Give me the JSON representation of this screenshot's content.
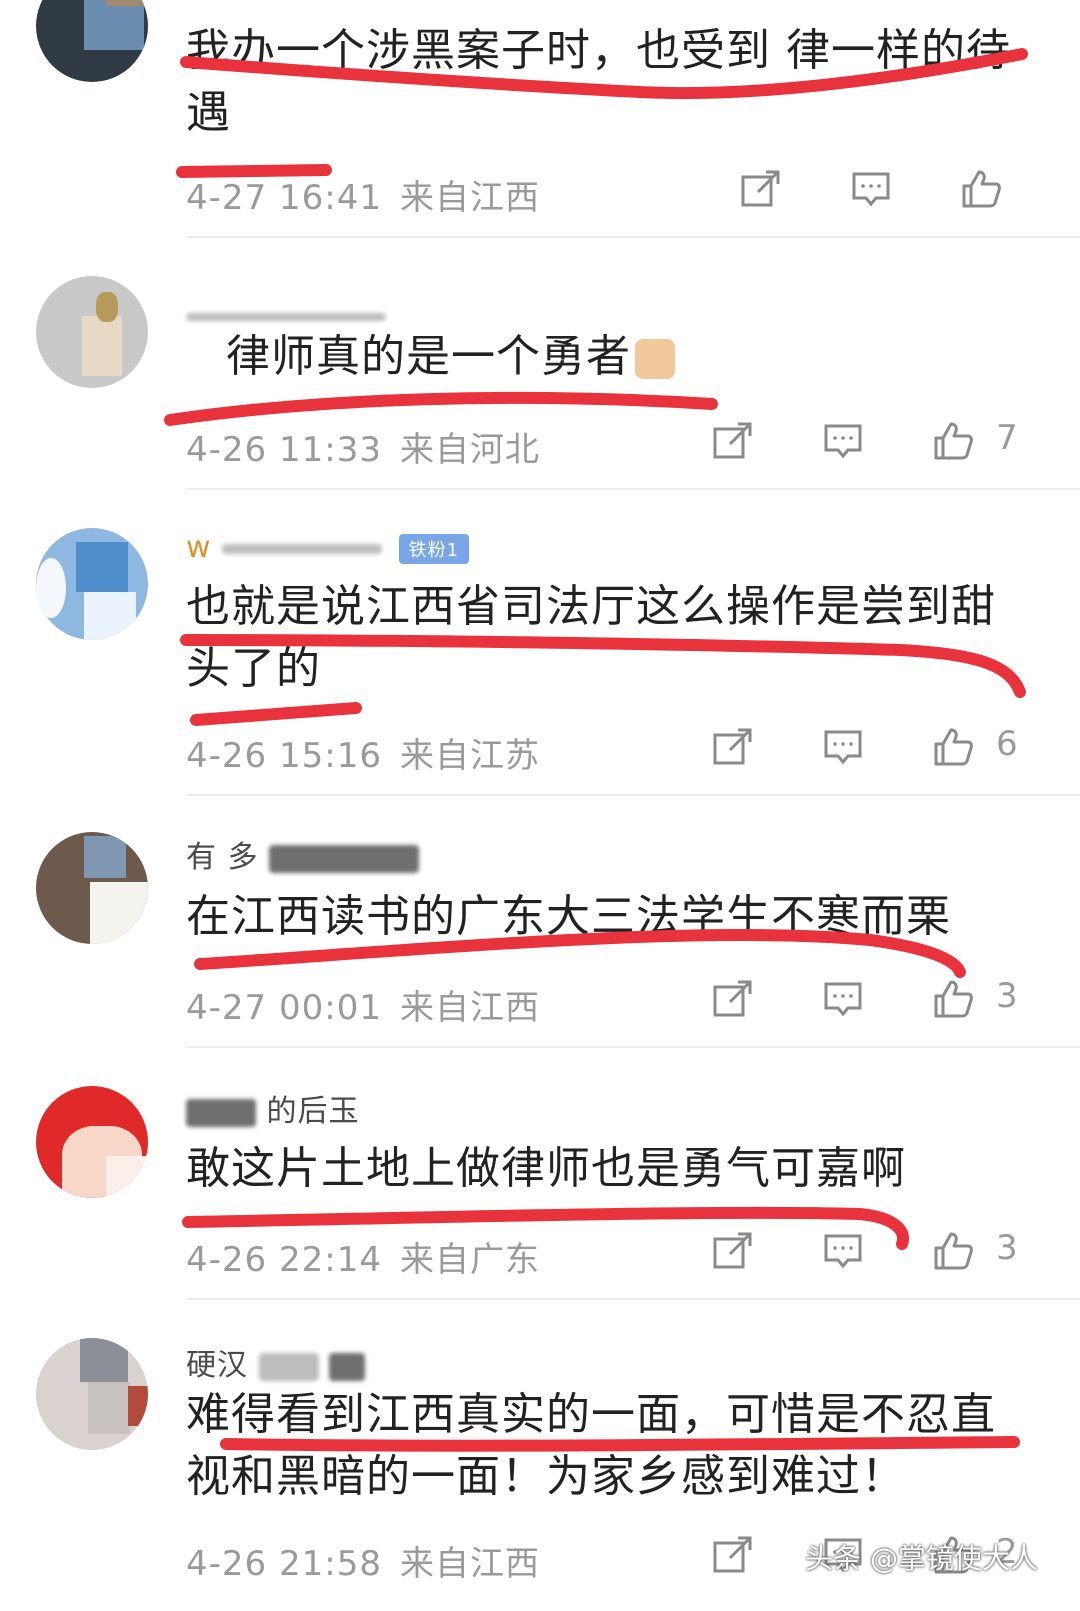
{
  "comments": [
    {
      "username": "",
      "text": "我办一个涉黑案子时，也受到 律一样的待遇",
      "time": "4-27 16:41",
      "location": "来自江西",
      "likes": ""
    },
    {
      "username": "",
      "text": "律师真的是一个勇者",
      "time": "4-26 11:33",
      "location": "来自河北",
      "likes": "7"
    },
    {
      "username": "w",
      "badge": "铁粉1",
      "text": "也就是说江西省司法厅这么操作是尝到甜头了的",
      "time": "4-26 15:16",
      "location": "来自江苏",
      "likes": "6"
    },
    {
      "username": "有 多",
      "text": "在江西读书的广东大三法学生不寒而栗",
      "time": "4-27 00:01",
      "location": "来自江西",
      "likes": "3"
    },
    {
      "username": "的后玉",
      "text": "敢这片土地上做律师也是勇气可嘉啊",
      "time": "4-26 22:14",
      "location": "来自广东",
      "likes": "3"
    },
    {
      "username": "硬汉",
      "text": "难得看到江西真实的一面，可惜是不忍直视和黑暗的一面！为家乡感到难过！",
      "time": "4-26 21:58",
      "location": "来自江西",
      "likes": "2"
    }
  ],
  "watermark": "头条 @掌镜使大人",
  "icons": {
    "share": "share-icon",
    "comment": "comment-icon",
    "like": "thumbs-up-icon"
  },
  "colors": {
    "annotation_red": "#e8323c",
    "meta_gray": "#9a9a9a",
    "text_dark": "#222222"
  }
}
